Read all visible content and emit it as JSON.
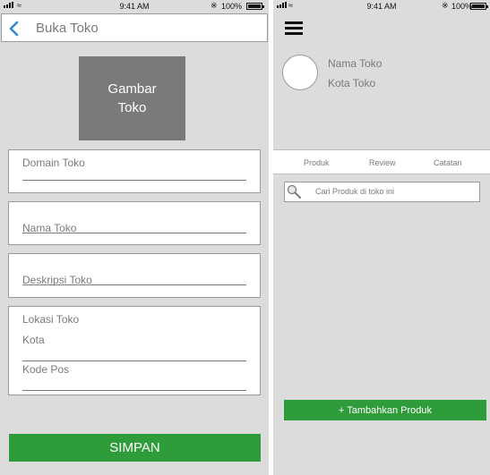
{
  "status_bar": {
    "time": "9:41 AM",
    "battery": "100%",
    "battery_level": 1.0
  },
  "left_screen": {
    "header": {
      "title": "Buka Toko",
      "back_icon": "chevron-left-icon"
    },
    "store_image": {
      "line1": "Gambar",
      "line2": "Toko"
    },
    "form": {
      "domain_label": "Domain Toko",
      "name_label": "Nama Toko",
      "description_label": "Deskripsi Toko",
      "location": {
        "title": "Lokasi Toko",
        "city_label": "Kota",
        "postal_label": "Kode Pos"
      }
    },
    "save_button": "SIMPAN"
  },
  "right_screen": {
    "menu_icon": "hamburger-menu-icon",
    "profile": {
      "name": "Nama Toko",
      "city": "Kota Toko"
    },
    "tabs": [
      "Produk",
      "Review",
      "Catatan"
    ],
    "search": {
      "placeholder": "Cari Produk di toko ini",
      "icon": "search-icon"
    },
    "add_button": "+ Tambahkan Produk"
  },
  "colors": {
    "background": "#dcdcdc",
    "accent_green": "#2e9c3a",
    "back_blue": "#2e86d6",
    "image_placeholder": "#7a7a7a"
  }
}
